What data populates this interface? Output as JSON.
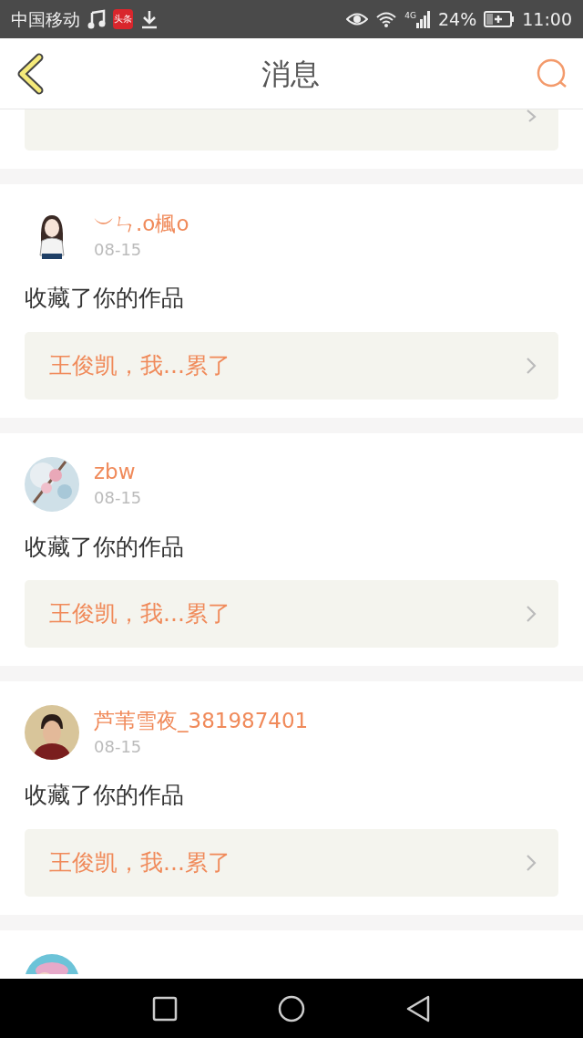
{
  "status_bar": {
    "carrier": "中国移动",
    "app_badge": "头条",
    "network": "4G",
    "battery": "24%",
    "time": "11:00"
  },
  "header": {
    "title": "消息"
  },
  "messages": [
    {
      "kind": "cut_top"
    },
    {
      "kind": "full",
      "user": "︶ㄣ.o楓o",
      "date": "08-15",
      "action": "收藏了你的作品",
      "work": "王俊凯，我...累了"
    },
    {
      "kind": "full",
      "user": "zbw",
      "date": "08-15",
      "action": "收藏了你的作品",
      "work": "王俊凯，我...累了"
    },
    {
      "kind": "full",
      "user": "芦苇雪夜_381987401",
      "date": "08-15",
      "action": "收藏了你的作品",
      "work": "王俊凯，我...累了"
    },
    {
      "kind": "cut_bottom"
    }
  ]
}
